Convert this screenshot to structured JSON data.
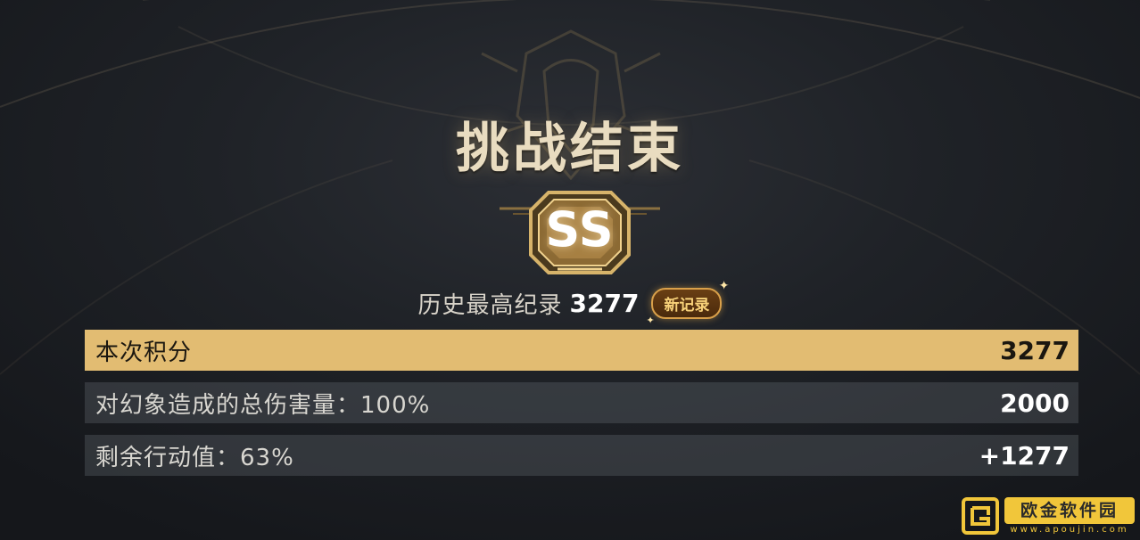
{
  "header": {
    "title": "挑战结束"
  },
  "rank": {
    "grade": "SS"
  },
  "record": {
    "label": "历史最高纪录",
    "value": "3277",
    "new_badge": "新记录"
  },
  "score_rows": [
    {
      "label": "本次积分",
      "value": "3277",
      "highlight": true
    },
    {
      "label": "对幻象造成的总伤害量：100%",
      "value": "2000",
      "highlight": false
    },
    {
      "label": "剩余行动值：63%",
      "value": "+1277",
      "highlight": false
    }
  ],
  "watermark": {
    "title": "欧金软件园",
    "url": "www.apoujin.com"
  },
  "colors": {
    "gold": "#e2bc72",
    "badge_gold": "#d9a04a",
    "watermark_yellow": "#f1c63a"
  },
  "icons": {
    "rank_badge": "octagon-rank-emblem-icon",
    "watermark_logo": "square-logo-icon",
    "sparkle": "sparkle-icon"
  }
}
